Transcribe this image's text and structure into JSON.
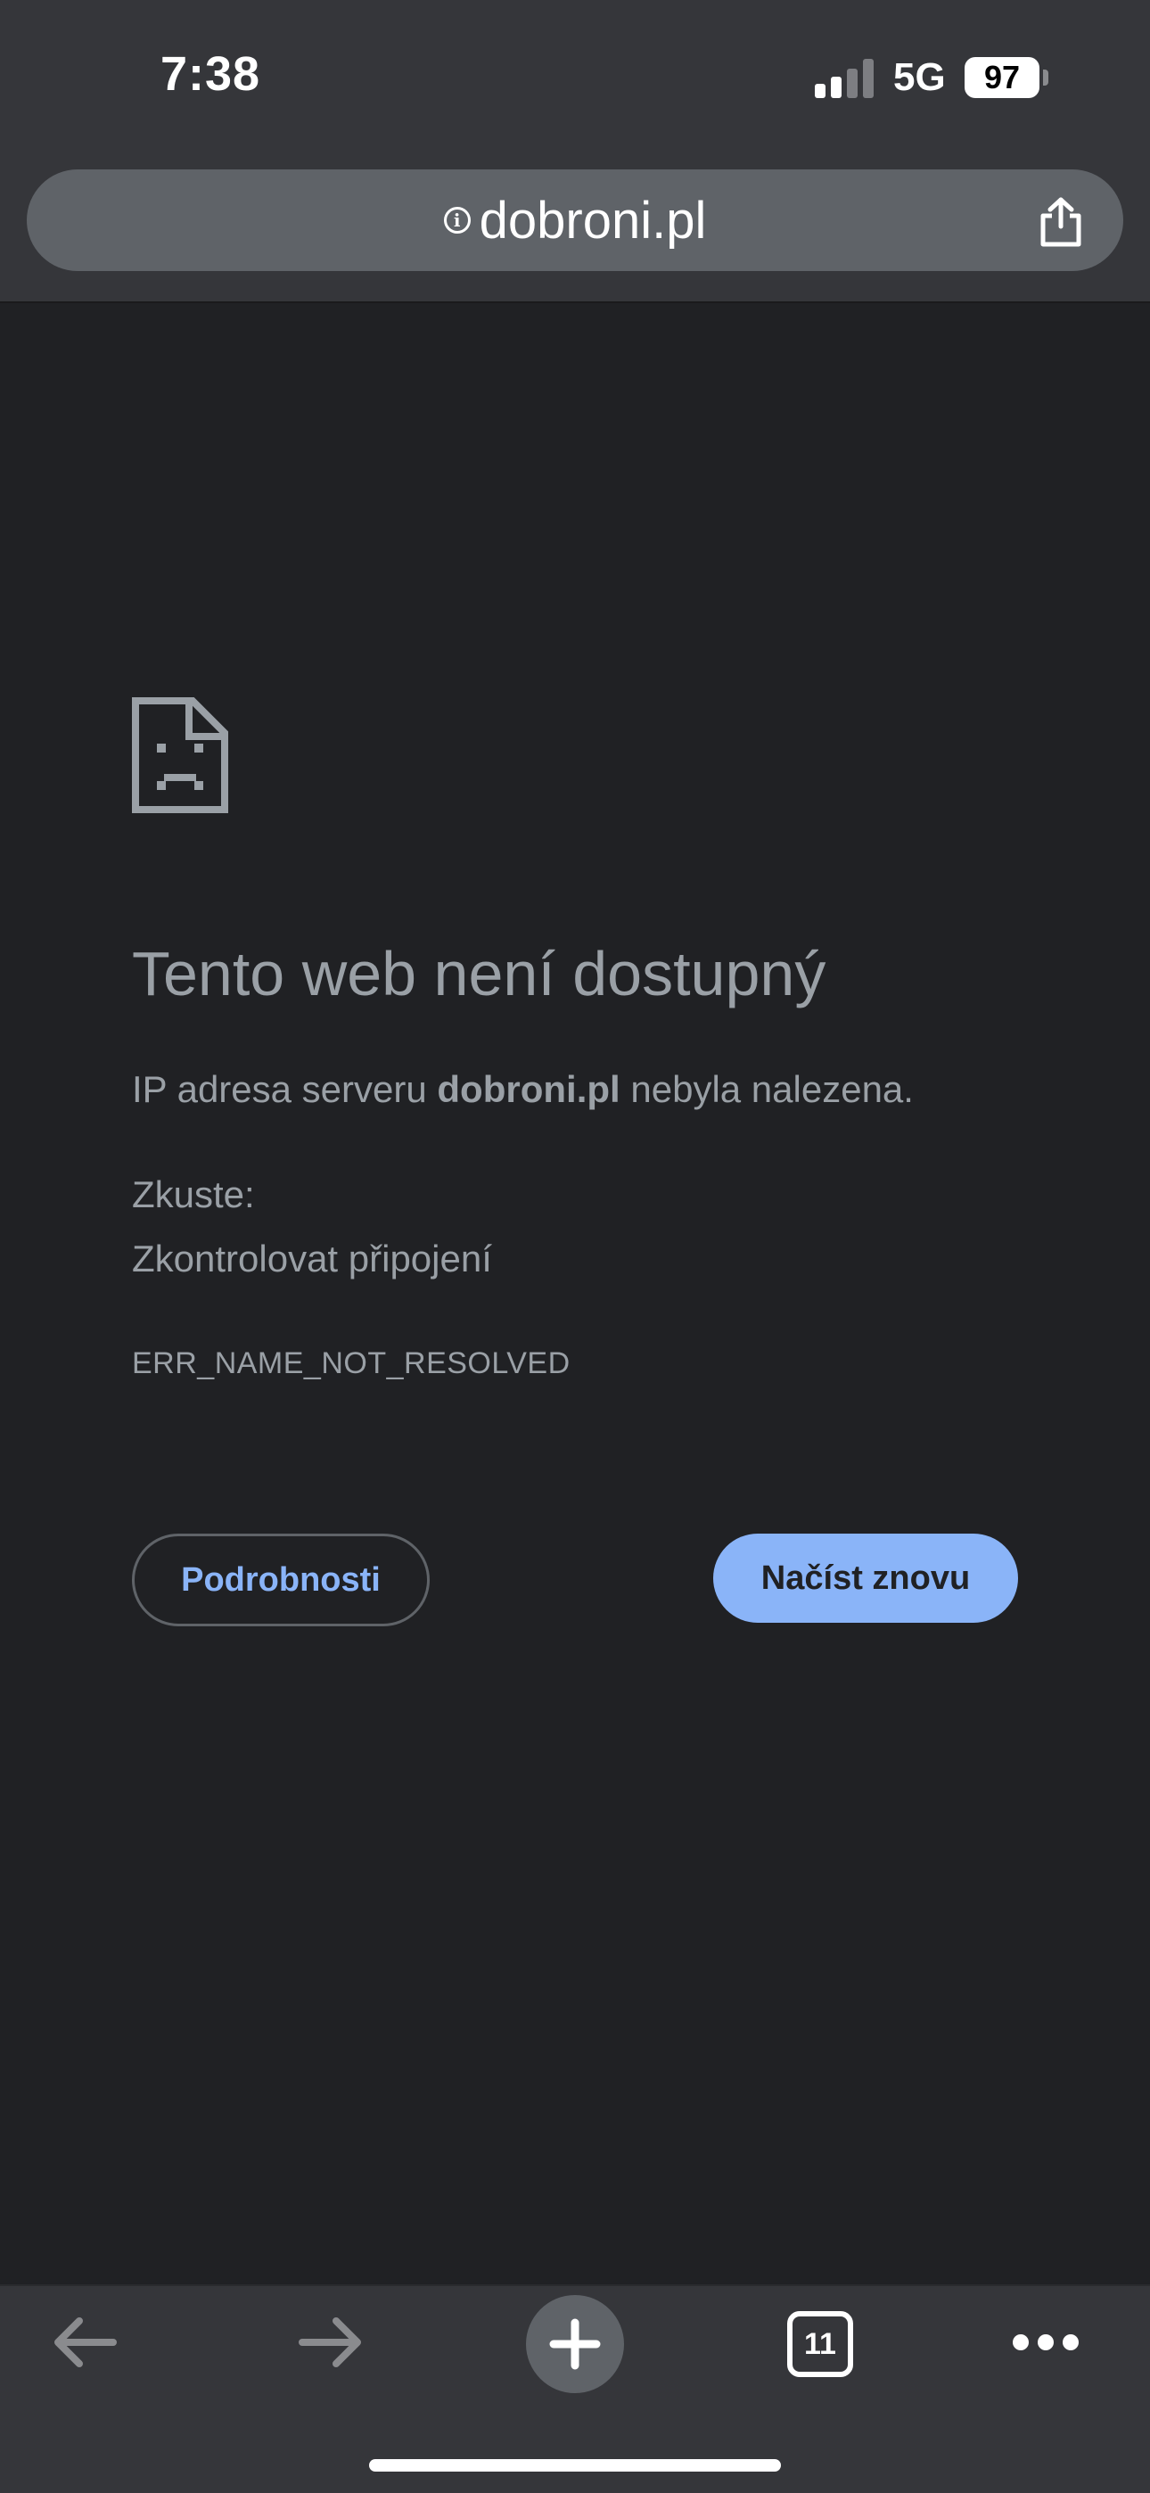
{
  "status_bar": {
    "time": "7:38",
    "network": "5G",
    "battery": "97"
  },
  "url_bar": {
    "url": "dobroni.pl",
    "info_icon": "info-icon",
    "share_icon": "share-icon"
  },
  "error": {
    "icon": "sad-page-icon",
    "title": "Tento web není dostupný",
    "desc_prefix": "IP adresa serveru ",
    "desc_domain": "dobroni.pl",
    "desc_suffix": " nebyla nalezena.",
    "try_label": "Zkuste:",
    "try_items": [
      "Zkontrolovat připojení"
    ],
    "code": "ERR_NAME_NOT_RESOLVED"
  },
  "buttons": {
    "details": "Podrobnosti",
    "reload": "Načíst znovu"
  },
  "toolbar": {
    "back_icon": "back-arrow-icon",
    "forward_icon": "forward-arrow-icon",
    "new_tab_icon": "plus-icon",
    "tab_count": "11",
    "menu_icon": "more-dots-icon"
  },
  "colors": {
    "background": "#202124",
    "chrome": "#35363a",
    "accent": "#8ab4f8",
    "text_muted": "#9aa0a6"
  }
}
